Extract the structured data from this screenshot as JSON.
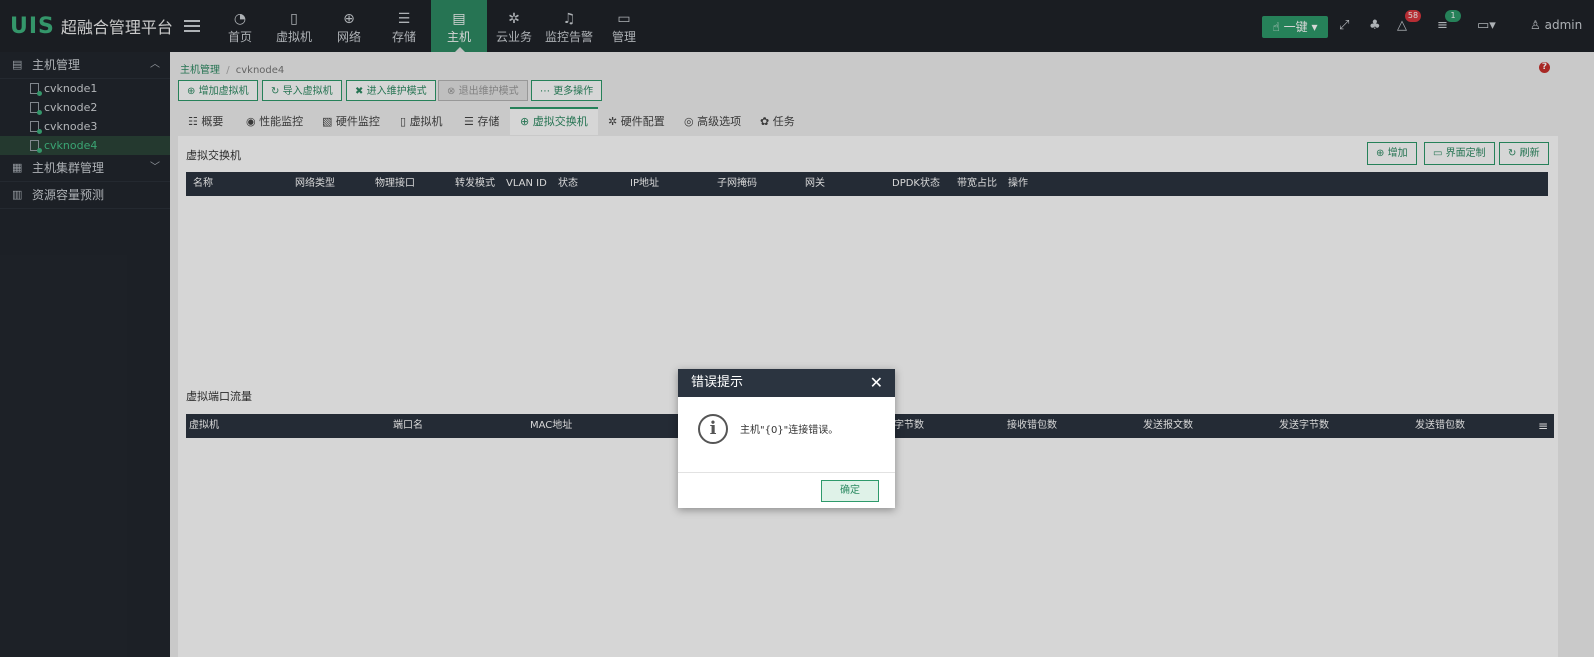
{
  "app": {
    "logo": "UIS",
    "title": "超融合管理平台"
  },
  "topnav": [
    {
      "label": "首页",
      "icon": "dashboard-icon",
      "glyph": "◔"
    },
    {
      "label": "虚拟机",
      "icon": "vm-icon",
      "glyph": "▯"
    },
    {
      "label": "网络",
      "icon": "globe-icon",
      "glyph": "⊕"
    },
    {
      "label": "存储",
      "icon": "database-icon",
      "glyph": "☰"
    },
    {
      "label": "主机",
      "icon": "host-icon",
      "glyph": "▤",
      "active": true
    },
    {
      "label": "云业务",
      "icon": "gear-icon",
      "glyph": "✲"
    },
    {
      "label": "监控告警",
      "icon": "bell-icon",
      "glyph": "♫"
    },
    {
      "label": "管理",
      "icon": "monitor-icon",
      "glyph": "▭"
    }
  ],
  "topbar": {
    "onekey": "一键",
    "alarm_count": "58",
    "task_count": "1",
    "user": "admin"
  },
  "sidebar": {
    "host_mgmt": "主机管理",
    "nodes": [
      "cvknode1",
      "cvknode2",
      "cvknode3",
      "cvknode4"
    ],
    "active_node": "cvknode4",
    "cluster_mgmt": "主机集群管理",
    "capacity": "资源容量预测"
  },
  "breadcrumb": {
    "root": "主机管理",
    "sep": "/",
    "current": "cvknode4"
  },
  "actions": [
    "增加虚拟机",
    "导入虚拟机",
    "进入维护模式",
    "退出维护模式",
    "更多操作"
  ],
  "tabs": [
    "概要",
    "性能监控",
    "硬件监控",
    "虚拟机",
    "存储",
    "虚拟交换机",
    "硬件配置",
    "高级选项",
    "任务"
  ],
  "active_tab": "虚拟交换机",
  "vswitch": {
    "title": "虚拟交换机",
    "buttons": [
      "增加",
      "界面定制",
      "刷新"
    ],
    "columns": [
      "名称",
      "网络类型",
      "物理接口",
      "转发模式",
      "VLAN ID",
      "状态",
      "IP地址",
      "子网掩码",
      "网关",
      "DPDK状态",
      "带宽占比",
      "操作"
    ]
  },
  "traffic": {
    "title": "虚拟端口流量",
    "columns": [
      "虚拟机",
      "端口名",
      "MAC地址",
      "字节数",
      "接收错包数",
      "发送报文数",
      "发送字节数",
      "发送错包数"
    ]
  },
  "modal": {
    "title": "错误提示",
    "close": "✕",
    "message": "主机\"{0}\"连接错误。",
    "ok": "确定"
  },
  "colors": {
    "accent": "#2e9a6b",
    "header": "#2b3440",
    "sidebar": "#22272e",
    "danger": "#c9302c"
  }
}
